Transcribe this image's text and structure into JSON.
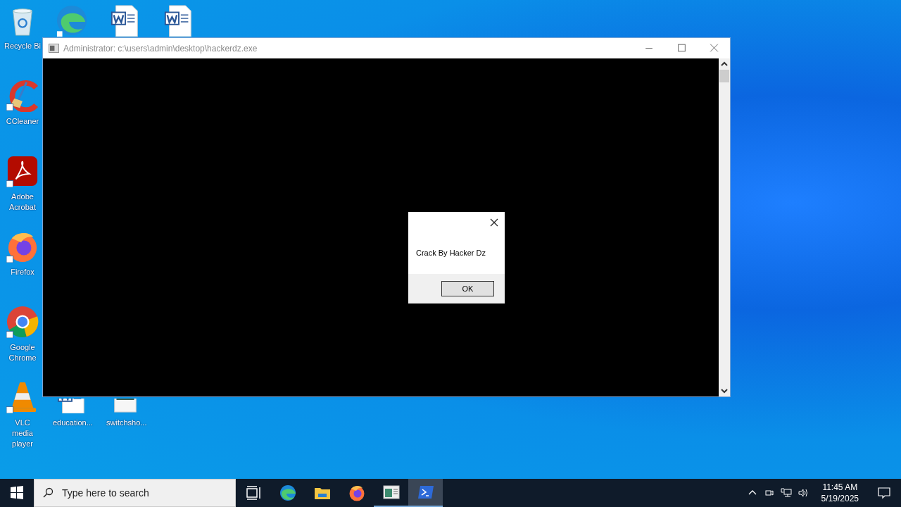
{
  "desktop_icons": [
    {
      "kind": "recycle",
      "label": "Recycle Bi"
    },
    {
      "kind": "ccleaner",
      "label": "CCleaner"
    },
    {
      "kind": "acrobat",
      "label": "Adobe Acrobat"
    },
    {
      "kind": "firefox",
      "label": "Firefox"
    },
    {
      "kind": "chrome",
      "label": "Google Chrome"
    },
    {
      "kind": "vlc",
      "label": "VLC media player"
    },
    {
      "kind": "edge"
    },
    {
      "kind": "word",
      "label": "education..."
    },
    {
      "kind": "word"
    },
    {
      "kind": "image",
      "label": "switchsho..."
    },
    {
      "kind": "word"
    }
  ],
  "window": {
    "title": "Administrator: c:\\users\\admin\\desktop\\hackerdz.exe"
  },
  "dialog": {
    "message": "Crack By Hacker Dz",
    "button": "OK"
  },
  "taskbar": {
    "search": {
      "placeholder": "Type here to search"
    },
    "apps": [
      {
        "kind": "taskview",
        "running": false,
        "selected": false
      },
      {
        "kind": "edge",
        "running": false,
        "selected": false
      },
      {
        "kind": "folder",
        "running": false,
        "selected": false
      },
      {
        "kind": "firefox",
        "running": false,
        "selected": false
      },
      {
        "kind": "console",
        "running": true,
        "selected": false
      },
      {
        "kind": "powershell",
        "running": true,
        "selected": true
      }
    ],
    "clock": {
      "time": "11:45 AM",
      "date": "5/19/2025"
    }
  }
}
